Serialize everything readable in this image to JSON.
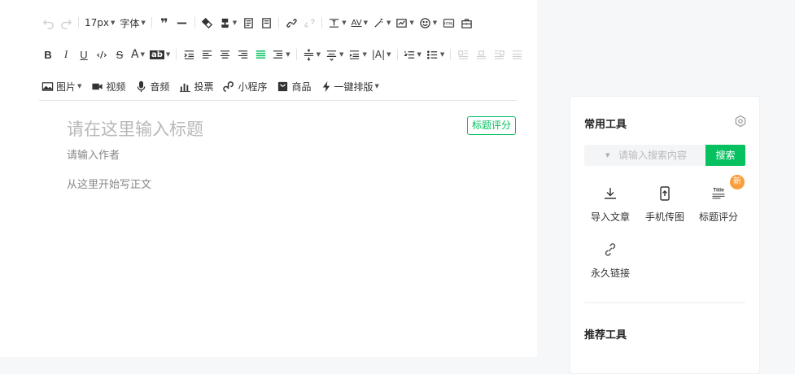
{
  "toolbar": {
    "font_size": "17px",
    "font_family": "字体",
    "bold": "B",
    "italic": "I",
    "underline": "U",
    "code": "‹/›",
    "strike": "S",
    "font_color": "A",
    "bg_color": "ab",
    "av": "AV",
    "letter_spacing": "|A|",
    "html_icon_text": "HTML",
    "title_icon_text": "Title",
    "insert": {
      "image": "图片",
      "video": "视频",
      "audio": "音频",
      "vote": "投票",
      "miniprogram": "小程序",
      "product": "商品",
      "one_click_layout": "一键排版"
    }
  },
  "editor": {
    "title_placeholder": "请在这里输入标题",
    "title_score_button": "标题评分",
    "author_placeholder": "请输入作者",
    "body_placeholder": "从这里开始写正文"
  },
  "panel": {
    "title": "常用工具",
    "search_placeholder": "请输入搜索内容",
    "search_button": "搜索",
    "tools": [
      {
        "label": "导入文章",
        "icon": "import-icon"
      },
      {
        "label": "手机传图",
        "icon": "phone-upload-icon"
      },
      {
        "label": "标题评分",
        "icon": "title-score-icon",
        "badge": "新"
      },
      {
        "label": "永久链接",
        "icon": "link-icon"
      }
    ],
    "section2_title": "推荐工具"
  },
  "colors": {
    "accent": "#07c160",
    "badge": "#fa9d3b"
  }
}
